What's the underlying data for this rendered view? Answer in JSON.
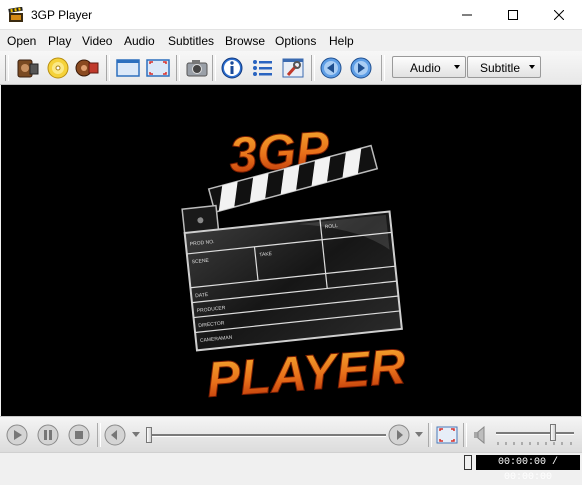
{
  "window": {
    "title": "3GP Player"
  },
  "menu": [
    "Open",
    "Play",
    "Video",
    "Audio",
    "Subtitles",
    "Browse",
    "Options",
    "Help"
  ],
  "toolbar": {
    "audio_label": "Audio",
    "subtitle_label": "Subtitle"
  },
  "splash": {
    "top_text": "3GP",
    "bottom_text": "PLAYER",
    "clapper_labels": {
      "prod_no": "PROD NO.",
      "scene": "SCENE",
      "take": "TAKE",
      "roll": "ROLL",
      "date": "DATE",
      "producer": "PRODUCER",
      "director": "DIRECTOR",
      "cameraman": "CAMERAMAN"
    }
  },
  "player": {
    "seek_position": 0.0,
    "volume_level": 0.75
  },
  "status": {
    "time": "00:00:00 / 00:00:00"
  },
  "colors": {
    "logo_orange": "#f29a1c",
    "logo_red": "#b32a06",
    "video_bg": "#000000"
  }
}
